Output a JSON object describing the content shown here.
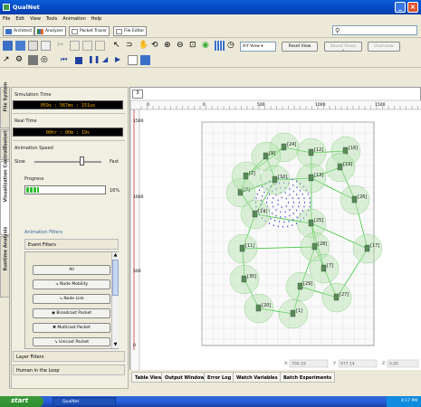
{
  "window": {
    "title": "QualNet"
  },
  "menu": [
    "File",
    "Edit",
    "View",
    "Tools",
    "Animation",
    "Help"
  ],
  "modes": [
    {
      "label": "Architect",
      "color": "#3a70c8"
    },
    {
      "label": "Analyzer",
      "color": "#2a8a2a"
    },
    {
      "label": "Packet Tracer",
      "color": "#888888"
    },
    {
      "label": "File Editor",
      "color": "#888888"
    }
  ],
  "toolbar": {
    "view_combo": "X-Y View",
    "reset_view": "Reset View",
    "saved_views": "Saved Views",
    "overview": "Overview"
  },
  "side_tabs": [
    "File System",
    "Toolset",
    "Visualization Controls",
    "Runtime Analysis"
  ],
  "left": {
    "sim_time_label": "Simulation Time",
    "sim_time_value": "059s : 567ms : 151us",
    "real_time_label": "Real Time",
    "real_time_value": "00hr : 00m : 19s",
    "anim_speed_label": "Animation Speed",
    "slow": "Slow",
    "fast": "Fast",
    "progress_label": "Progress",
    "progress_value": "16%",
    "progress_fraction": 0.16,
    "anim_filters": "Animation Filters",
    "event_filters": "Event Filters",
    "filter_buttons": [
      "All",
      "Node Mobility",
      "Node Link",
      "Broadcast Packet",
      "Multicast Packet",
      "Unicast Packet"
    ],
    "layer_filters": "Layer Filters",
    "human_loop": "Human in the Loop"
  },
  "canvas": {
    "tab": "3",
    "ruler_top": [
      "0",
      "0",
      "500",
      "1000",
      "1500"
    ],
    "ruler_left": [
      "1500",
      "1000",
      "500",
      "0"
    ],
    "node_labels": [
      "[16]",
      "[24]",
      "[9]",
      "[12]",
      "[19]",
      "[26]",
      "[8]",
      "[13]",
      "[10]",
      "[2]",
      "[14]",
      "[25]",
      "[17]",
      "[28]",
      "[11]",
      "[30]",
      "[7]",
      "[29]",
      "[1]",
      "[20]",
      "[27]"
    ],
    "coords": {
      "x_label": "X:",
      "x": "709.19",
      "y_label": "Y:",
      "y": "977.14",
      "z_label": "Z:",
      "z": "0.00"
    }
  },
  "bottom_tabs": [
    "Table View",
    "Output Window",
    "Error Log",
    "Watch Variables",
    "Batch Experiments"
  ],
  "taskbar": {
    "start": "start",
    "item": "QualNet",
    "clock": "4:17 PM"
  },
  "colors": {
    "node_fill": "#b6e3b0",
    "link": "#22c022",
    "router": "#5a8a5a",
    "signal": "#3a3ad0"
  }
}
